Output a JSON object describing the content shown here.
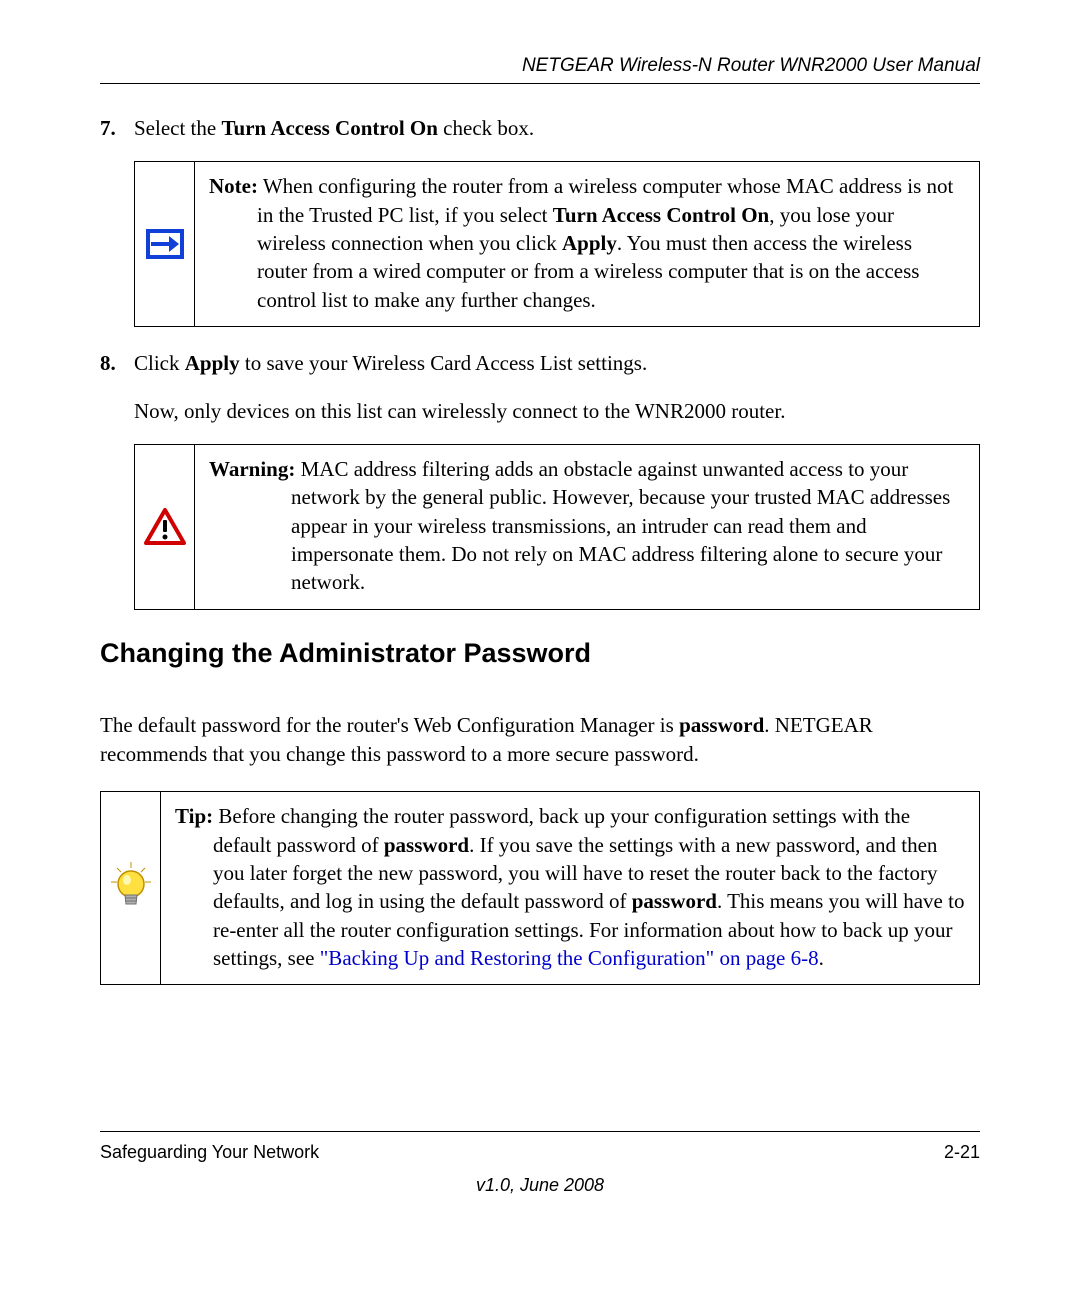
{
  "header": {
    "title": "NETGEAR Wireless-N Router WNR2000 User Manual"
  },
  "step7": {
    "num": "7.",
    "pre": "Select the ",
    "bold": "Turn Access Control On",
    "post": " check box."
  },
  "note": {
    "label": "Note:",
    "t1": " When configuring the router from a wireless computer whose MAC address is not in the Trusted PC list, if you select ",
    "bold1": "Turn Access Control On",
    "t2": ", you lose your wireless connection when you click ",
    "bold2": "Apply",
    "t3": ". You must then access the wireless router from a wired computer or from a wireless computer that is on the access control list to make any further changes."
  },
  "step8": {
    "num": "8.",
    "pre": "Click ",
    "bold": "Apply",
    "post": " to save your Wireless Card Access List settings."
  },
  "step8_follow": "Now, only devices on this list can wirelessly connect to the WNR2000 router.",
  "warning": {
    "label": "Warning:",
    "text": " MAC address filtering adds an obstacle against unwanted access to your network by the general public. However, because your trusted MAC addresses appear in your wireless transmissions, an intruder can read them and impersonate them. Do not rely on MAC address filtering alone to secure your network."
  },
  "section_heading": "Changing the Administrator Password",
  "intro": {
    "t1": "The default password for the router's Web Configuration Manager is ",
    "bold1": "password",
    "t2": ". NETGEAR recommends that you change this password to a more secure password."
  },
  "tip": {
    "label": "Tip:",
    "t1": " Before changing the router password, back up your configuration settings with the default password of ",
    "bold1": "password",
    "t2": ". If you save the settings with a new password, and then you later forget the new password, you will have to reset the router back to the factory defaults, and log in using the default password of ",
    "bold2": "password",
    "t3": ". This means you will have to re-enter all the router configuration settings. For information about how to back up your settings, see ",
    "link": "\"Backing Up and Restoring the Configuration\" on page 6-8",
    "t4": "."
  },
  "footer": {
    "left": "Safeguarding Your Network",
    "right": "2-21",
    "version": "v1.0, June 2008"
  }
}
